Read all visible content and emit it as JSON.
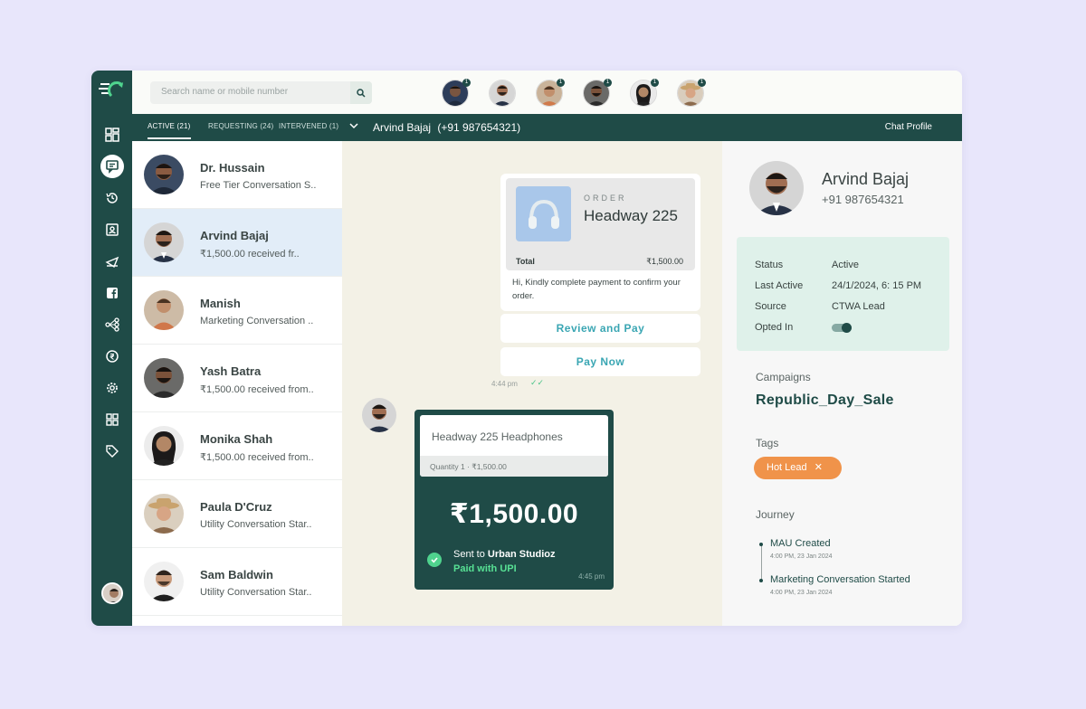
{
  "search": {
    "placeholder": "Search name or mobile number"
  },
  "stories": [
    {
      "badge": "1"
    },
    {
      "badge": ""
    },
    {
      "badge": "1"
    },
    {
      "badge": "1"
    },
    {
      "badge": "1"
    },
    {
      "badge": "1"
    }
  ],
  "tabs": [
    {
      "label": "ACTIVE (21)"
    },
    {
      "label": "REQUESTING (24)"
    },
    {
      "label": "INTERVENED (1)"
    }
  ],
  "chat_header": {
    "name": "Arvind Bajaj",
    "phone": "(+91 987654321)",
    "profile_link": "Chat Profile"
  },
  "conversations": [
    {
      "name": "Dr. Hussain",
      "preview": "Free Tier Conversation S.."
    },
    {
      "name": "Arvind Bajaj",
      "preview": "₹1,500.00 received fr.."
    },
    {
      "name": "Manish",
      "preview": "Marketing Conversation .."
    },
    {
      "name": "Yash Batra",
      "preview": "₹1,500.00 received from.."
    },
    {
      "name": "Monika Shah",
      "preview": "₹1,500.00 received from.."
    },
    {
      "name": "Paula D'Cruz",
      "preview": "Utility Conversation Star.."
    },
    {
      "name": "Sam Baldwin",
      "preview": "Utility Conversation Star.."
    }
  ],
  "order_message": {
    "label": "ORDER",
    "product": "Headway 225",
    "total_label": "Total",
    "total_value": "₹1,500.00",
    "text": "Hi, Kindly complete payment to confirm your order.",
    "button_review": "Review and Pay",
    "button_pay": "Pay Now",
    "time": "4:44 pm",
    "tick": "✓✓"
  },
  "payment_message": {
    "product": "Headway 225 Headphones",
    "quantity": "Quantity 1 · ₹1,500.00",
    "amount": "₹1,500.00",
    "sent_prefix": "Sent to ",
    "sent_to": "Urban Studioz",
    "paid_with": "Paid with UPI",
    "time": "4:45 pm"
  },
  "profile": {
    "name": "Arvind Bajaj",
    "phone": "+91 987654321",
    "status_label": "Status",
    "status_value": "Active",
    "last_active_label": "Last Active",
    "last_active_value": "24/1/2024, 6: 15 PM",
    "source_label": "Source",
    "source_value": "CTWA Lead",
    "opted_in_label": "Opted In",
    "opted_in": true,
    "campaigns_label": "Campaigns",
    "campaign": "Republic_Day_Sale",
    "tags_label": "Tags",
    "tag": "Hot Lead",
    "tag_close": "✕",
    "journey_label": "Journey",
    "journey": [
      {
        "title": "MAU Created",
        "time": "4:00 PM, 23 Jan 2024"
      },
      {
        "title": "Marketing Conversation Started",
        "time": "4:00 PM, 23 Jan 2024"
      }
    ]
  },
  "colors": {
    "brand": "#1f4b47",
    "accent": "#3aa6b3",
    "tag": "#f0934a",
    "success": "#4fd38e"
  }
}
